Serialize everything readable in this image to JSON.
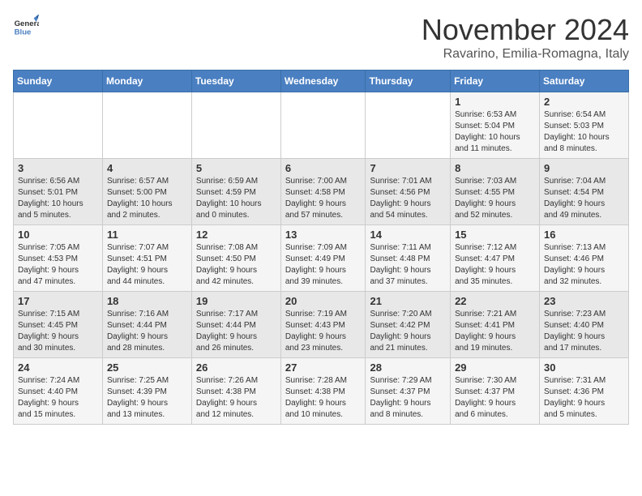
{
  "header": {
    "logo_line1": "General",
    "logo_line2": "Blue",
    "month_title": "November 2024",
    "subtitle": "Ravarino, Emilia-Romagna, Italy"
  },
  "weekdays": [
    "Sunday",
    "Monday",
    "Tuesday",
    "Wednesday",
    "Thursday",
    "Friday",
    "Saturday"
  ],
  "weeks": [
    [
      {
        "day": "",
        "info": ""
      },
      {
        "day": "",
        "info": ""
      },
      {
        "day": "",
        "info": ""
      },
      {
        "day": "",
        "info": ""
      },
      {
        "day": "",
        "info": ""
      },
      {
        "day": "1",
        "info": "Sunrise: 6:53 AM\nSunset: 5:04 PM\nDaylight: 10 hours\nand 11 minutes."
      },
      {
        "day": "2",
        "info": "Sunrise: 6:54 AM\nSunset: 5:03 PM\nDaylight: 10 hours\nand 8 minutes."
      }
    ],
    [
      {
        "day": "3",
        "info": "Sunrise: 6:56 AM\nSunset: 5:01 PM\nDaylight: 10 hours\nand 5 minutes."
      },
      {
        "day": "4",
        "info": "Sunrise: 6:57 AM\nSunset: 5:00 PM\nDaylight: 10 hours\nand 2 minutes."
      },
      {
        "day": "5",
        "info": "Sunrise: 6:59 AM\nSunset: 4:59 PM\nDaylight: 10 hours\nand 0 minutes."
      },
      {
        "day": "6",
        "info": "Sunrise: 7:00 AM\nSunset: 4:58 PM\nDaylight: 9 hours\nand 57 minutes."
      },
      {
        "day": "7",
        "info": "Sunrise: 7:01 AM\nSunset: 4:56 PM\nDaylight: 9 hours\nand 54 minutes."
      },
      {
        "day": "8",
        "info": "Sunrise: 7:03 AM\nSunset: 4:55 PM\nDaylight: 9 hours\nand 52 minutes."
      },
      {
        "day": "9",
        "info": "Sunrise: 7:04 AM\nSunset: 4:54 PM\nDaylight: 9 hours\nand 49 minutes."
      }
    ],
    [
      {
        "day": "10",
        "info": "Sunrise: 7:05 AM\nSunset: 4:53 PM\nDaylight: 9 hours\nand 47 minutes."
      },
      {
        "day": "11",
        "info": "Sunrise: 7:07 AM\nSunset: 4:51 PM\nDaylight: 9 hours\nand 44 minutes."
      },
      {
        "day": "12",
        "info": "Sunrise: 7:08 AM\nSunset: 4:50 PM\nDaylight: 9 hours\nand 42 minutes."
      },
      {
        "day": "13",
        "info": "Sunrise: 7:09 AM\nSunset: 4:49 PM\nDaylight: 9 hours\nand 39 minutes."
      },
      {
        "day": "14",
        "info": "Sunrise: 7:11 AM\nSunset: 4:48 PM\nDaylight: 9 hours\nand 37 minutes."
      },
      {
        "day": "15",
        "info": "Sunrise: 7:12 AM\nSunset: 4:47 PM\nDaylight: 9 hours\nand 35 minutes."
      },
      {
        "day": "16",
        "info": "Sunrise: 7:13 AM\nSunset: 4:46 PM\nDaylight: 9 hours\nand 32 minutes."
      }
    ],
    [
      {
        "day": "17",
        "info": "Sunrise: 7:15 AM\nSunset: 4:45 PM\nDaylight: 9 hours\nand 30 minutes."
      },
      {
        "day": "18",
        "info": "Sunrise: 7:16 AM\nSunset: 4:44 PM\nDaylight: 9 hours\nand 28 minutes."
      },
      {
        "day": "19",
        "info": "Sunrise: 7:17 AM\nSunset: 4:44 PM\nDaylight: 9 hours\nand 26 minutes."
      },
      {
        "day": "20",
        "info": "Sunrise: 7:19 AM\nSunset: 4:43 PM\nDaylight: 9 hours\nand 23 minutes."
      },
      {
        "day": "21",
        "info": "Sunrise: 7:20 AM\nSunset: 4:42 PM\nDaylight: 9 hours\nand 21 minutes."
      },
      {
        "day": "22",
        "info": "Sunrise: 7:21 AM\nSunset: 4:41 PM\nDaylight: 9 hours\nand 19 minutes."
      },
      {
        "day": "23",
        "info": "Sunrise: 7:23 AM\nSunset: 4:40 PM\nDaylight: 9 hours\nand 17 minutes."
      }
    ],
    [
      {
        "day": "24",
        "info": "Sunrise: 7:24 AM\nSunset: 4:40 PM\nDaylight: 9 hours\nand 15 minutes."
      },
      {
        "day": "25",
        "info": "Sunrise: 7:25 AM\nSunset: 4:39 PM\nDaylight: 9 hours\nand 13 minutes."
      },
      {
        "day": "26",
        "info": "Sunrise: 7:26 AM\nSunset: 4:38 PM\nDaylight: 9 hours\nand 12 minutes."
      },
      {
        "day": "27",
        "info": "Sunrise: 7:28 AM\nSunset: 4:38 PM\nDaylight: 9 hours\nand 10 minutes."
      },
      {
        "day": "28",
        "info": "Sunrise: 7:29 AM\nSunset: 4:37 PM\nDaylight: 9 hours\nand 8 minutes."
      },
      {
        "day": "29",
        "info": "Sunrise: 7:30 AM\nSunset: 4:37 PM\nDaylight: 9 hours\nand 6 minutes."
      },
      {
        "day": "30",
        "info": "Sunrise: 7:31 AM\nSunset: 4:36 PM\nDaylight: 9 hours\nand 5 minutes."
      }
    ]
  ]
}
